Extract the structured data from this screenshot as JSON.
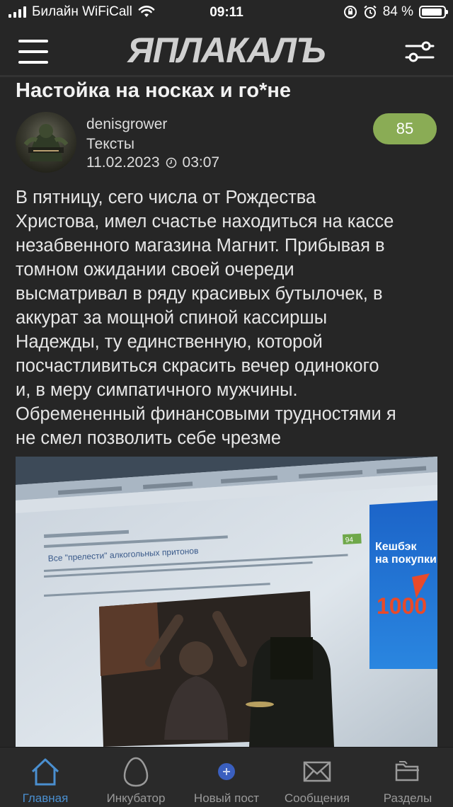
{
  "status_bar": {
    "carrier": "Билайн WiFiCall",
    "time": "09:11",
    "battery": "84 %"
  },
  "header": {
    "logo": "ЯПЛАКАЛЪ"
  },
  "post": {
    "title": "Настойка на носках и го*не",
    "author": "denisgrower",
    "section": "Тексты",
    "date": "11.02.2023",
    "time": "03:07",
    "rating": "85",
    "text": "В пятницу, сего числа от Рождества\nХристова, имел счастье находиться на кассе\nнезабвенного магазина Магнит. Прибывая в\nтомном ожидании своей очереди\nвысматривал в ряду красивых бутылочек, в\nаккурат за мощной спиной кассиршы\nНадежды, ту единственную, которой\nпосчастливиться скрасить вечер одинокого\nи, в меру симпатичного мужчины.\nОбремененный финансовыми трудностями я\nне смел позволить себе чрезме"
  },
  "photo_content": {
    "inner_title": "Все \"прелести\" алкогольных притонов",
    "inner_rating": "94",
    "ad_line1": "Кешбэк",
    "ad_line2": "на покупки",
    "ad_amount": "1000"
  },
  "bottom_nav": [
    {
      "label": "Главная",
      "icon": "home-icon",
      "active": true
    },
    {
      "label": "Инкубатор",
      "icon": "egg-icon",
      "active": false
    },
    {
      "label": "Новый пост",
      "icon": "plus-circle-icon",
      "active": false
    },
    {
      "label": "Сообщения",
      "icon": "mail-icon",
      "active": false
    },
    {
      "label": "Разделы",
      "icon": "folders-icon",
      "active": false
    }
  ],
  "colors": {
    "background": "#262626",
    "rating_badge": "#8aac55",
    "active_nav": "#4a8fd0"
  }
}
